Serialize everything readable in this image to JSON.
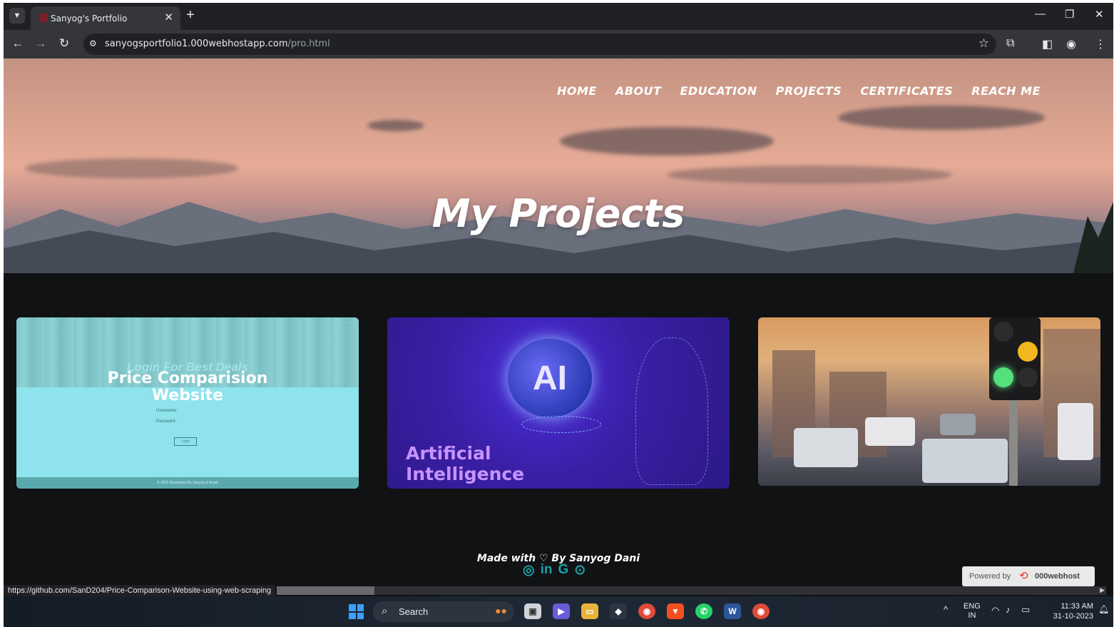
{
  "browser": {
    "tab_title": "Sanyog's Portfolio",
    "url_host": "sanyogsportfolio1.000webhostapp.com",
    "url_path": "/pro.html",
    "status_url": "https://github.com/SanD204/Price-Comparison-Website-using-web-scraping"
  },
  "nav": {
    "items": [
      "HOME",
      "ABOUT",
      "EDUCATION",
      "PROJECTS",
      "CERTIFICATES",
      "REACH ME"
    ]
  },
  "hero": {
    "title": "My Projects"
  },
  "projects": {
    "card1": {
      "faded_heading": "Login For Best Deals",
      "title_line1": "Price Comparision",
      "title_line2": "Website",
      "username_label": "Username:",
      "password_label": "Password:",
      "login_button": "Login",
      "footer_text": "© 2023 Developed By Sanyog & Arush"
    },
    "card2": {
      "ai_text": "AI",
      "caption_line1": "Artificial",
      "caption_line2": "Intelligence"
    }
  },
  "footer": {
    "made_prefix": "Made with",
    "made_suffix": "By Sanyog Dani",
    "powered_label": "Powered by",
    "powered_brand": "000webhost"
  },
  "taskbar": {
    "search_placeholder": "Search",
    "lang_line1": "ENG",
    "lang_line2": "IN",
    "time": "11:33 AM",
    "date": "31-10-2023"
  }
}
